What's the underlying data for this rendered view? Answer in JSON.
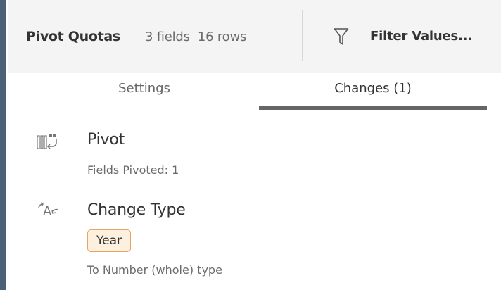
{
  "header": {
    "title": "Pivot Quotas",
    "meta": "3 fields  16 rows",
    "filter_label": "Filter Values..."
  },
  "tabs": [
    {
      "label": "Settings",
      "active": false
    },
    {
      "label": "Changes (1)",
      "active": true
    }
  ],
  "changes": [
    {
      "icon": "pivot-icon",
      "title": "Pivot",
      "detail": "Fields Pivoted: 1"
    },
    {
      "icon": "change-type-icon",
      "title": "Change Type",
      "field": "Year",
      "detail": "To Number (whole) type"
    }
  ],
  "colors": {
    "chip_border": "#e8a461",
    "chip_background": "#fdf0df",
    "active_tab_bar": "#666666",
    "header_background": "#f4f4f4",
    "window_border": "#4a6178"
  }
}
